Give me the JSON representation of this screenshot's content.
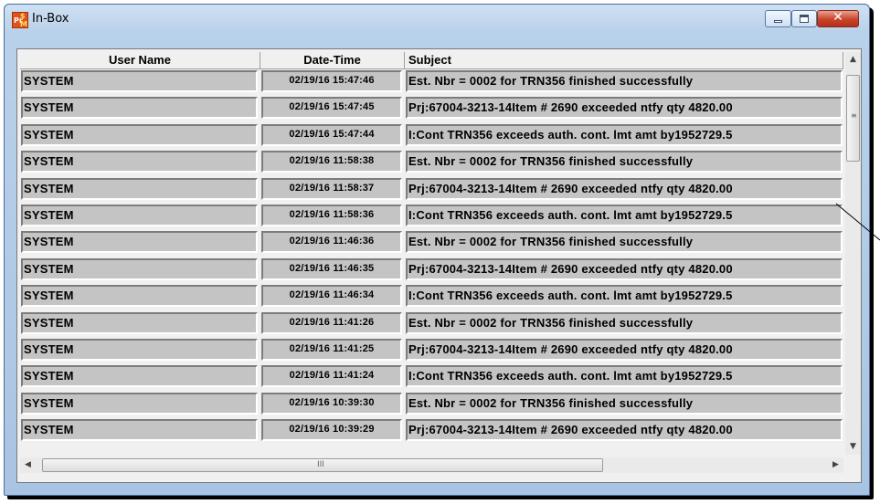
{
  "window": {
    "title": "In-Box",
    "icon": "prism-app-icon",
    "controls": {
      "minimize": "minimize-icon",
      "maximize": "maximize-icon",
      "close": "close-icon",
      "close_glyph": "✕"
    }
  },
  "table": {
    "columns": [
      "User Name",
      "Date-Time",
      "Subject"
    ],
    "rows": [
      {
        "user": "SYSTEM",
        "datetime": "02/19/16 15:47:46",
        "subject": "Est. Nbr = 0002 for TRN356 finished successfully"
      },
      {
        "user": "SYSTEM",
        "datetime": "02/19/16 15:47:45",
        "subject": "Prj:67004-3213-14Item # 2690 exceeded ntfy qty 4820.00"
      },
      {
        "user": "SYSTEM",
        "datetime": "02/19/16 15:47:44",
        "subject": "I:Cont TRN356 exceeds auth. cont. lmt amt by1952729.5"
      },
      {
        "user": "SYSTEM",
        "datetime": "02/19/16 11:58:38",
        "subject": "Est. Nbr = 0002 for TRN356 finished successfully"
      },
      {
        "user": "SYSTEM",
        "datetime": "02/19/16 11:58:37",
        "subject": "Prj:67004-3213-14Item # 2690 exceeded ntfy qty 4820.00"
      },
      {
        "user": "SYSTEM",
        "datetime": "02/19/16 11:58:36",
        "subject": "I:Cont TRN356 exceeds auth. cont. lmt amt by1952729.5"
      },
      {
        "user": "SYSTEM",
        "datetime": "02/19/16 11:46:36",
        "subject": "Est. Nbr = 0002 for TRN356 finished successfully"
      },
      {
        "user": "SYSTEM",
        "datetime": "02/19/16 11:46:35",
        "subject": "Prj:67004-3213-14Item # 2690 exceeded ntfy qty 4820.00"
      },
      {
        "user": "SYSTEM",
        "datetime": "02/19/16 11:46:34",
        "subject": "I:Cont TRN356 exceeds auth. cont. lmt amt by1952729.5"
      },
      {
        "user": "SYSTEM",
        "datetime": "02/19/16 11:41:26",
        "subject": "Est. Nbr = 0002 for TRN356 finished successfully"
      },
      {
        "user": "SYSTEM",
        "datetime": "02/19/16 11:41:25",
        "subject": "Prj:67004-3213-14Item # 2690 exceeded ntfy qty 4820.00"
      },
      {
        "user": "SYSTEM",
        "datetime": "02/19/16 11:41:24",
        "subject": "I:Cont TRN356 exceeds auth. cont. lmt amt by1952729.5"
      },
      {
        "user": "SYSTEM",
        "datetime": "02/19/16 10:39:30",
        "subject": "Est. Nbr = 0002 for TRN356 finished successfully"
      },
      {
        "user": "SYSTEM",
        "datetime": "02/19/16 10:39:29",
        "subject": "Prj:67004-3213-14Item # 2690 exceeded ntfy qty 4820.00"
      }
    ]
  },
  "scrollbars": {
    "up_glyph": "▲",
    "down_glyph": "▼",
    "left_glyph": "◀",
    "right_glyph": "▶",
    "h_grip": "III",
    "v_grip": "≡"
  },
  "colors": {
    "cell_bg": "#c4c4c4",
    "title_gradient_top": "#cfe0f3",
    "close_button": "#c8432a"
  }
}
